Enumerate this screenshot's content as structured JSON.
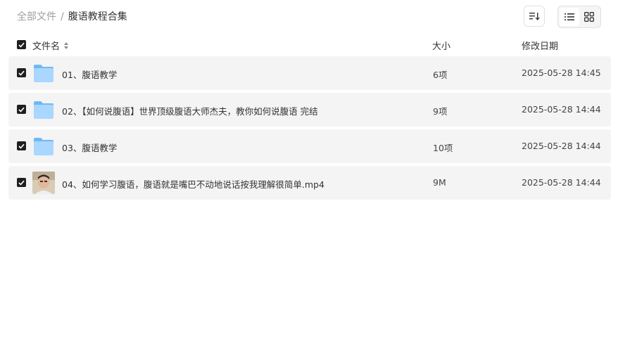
{
  "breadcrumb": {
    "root": "全部文件",
    "separator": "/",
    "current": "腹语教程合集"
  },
  "toolbar": {
    "sort_icon": "sort-list-icon",
    "list_view_icon": "list-view-icon",
    "grid_view_icon": "grid-view-icon",
    "active_view": "list"
  },
  "columns": {
    "name": "文件名",
    "size": "大小",
    "date": "修改日期"
  },
  "files": [
    {
      "name": "01、腹语教学",
      "size": "6项",
      "date": "2025-05-28 14:45",
      "type": "folder",
      "checked": true
    },
    {
      "name": "02、【如何说腹语】世界顶级腹语大师杰夫，教你如何说腹语 完结",
      "size": "9项",
      "date": "2025-05-28 14:44",
      "type": "folder",
      "checked": true
    },
    {
      "name": "03、腹语教学",
      "size": "10项",
      "date": "2025-05-28 14:44",
      "type": "folder",
      "checked": true
    },
    {
      "name": "04、如何学习腹语，腹语就是嘴巴不动地说话按我理解很简单.mp4",
      "size": "9M",
      "date": "2025-05-28 14:44",
      "type": "video",
      "checked": true
    }
  ],
  "colors": {
    "row_bg": "#f4f4f4",
    "folder_light": "#a9d7ff",
    "folder_dark": "#6fb8f5",
    "checkbox": "#1f1f1f"
  }
}
